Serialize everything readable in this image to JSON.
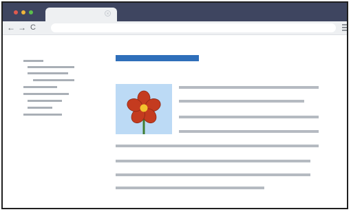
{
  "window": {
    "controls": [
      {
        "name": "close",
        "color": "#e05a4e"
      },
      {
        "name": "minimize",
        "color": "#f0b53a"
      },
      {
        "name": "maximize",
        "color": "#5cbf4b"
      }
    ],
    "tab": {
      "close_glyph": "×"
    }
  },
  "toolbar": {
    "back_glyph": "←",
    "forward_glyph": "→",
    "reload_glyph": "C",
    "address_value": ""
  },
  "page": {
    "heading_color": "#2f6fba",
    "image": {
      "subject": "red-flower",
      "background": "#bcdaf5",
      "petal_color": "#c43b1f",
      "center_color": "#f3c22e",
      "stem_color": "#3f7d33"
    },
    "text_color": "#b5bac1"
  }
}
